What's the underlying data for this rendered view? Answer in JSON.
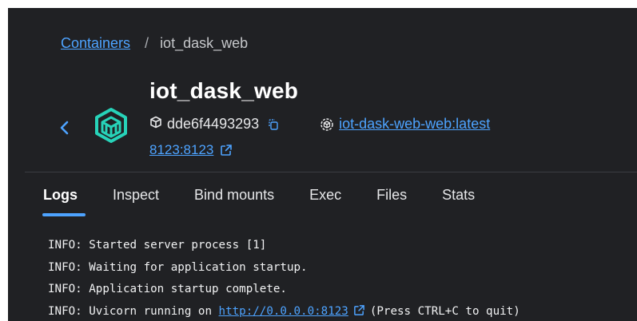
{
  "breadcrumb": {
    "root": "Containers",
    "separator": "/",
    "current": "iot_dask_web"
  },
  "container": {
    "name": "iot_dask_web",
    "id": "dde6f4493293",
    "image": "iot-dask-web-web:latest",
    "port": "8123:8123"
  },
  "tabs": [
    {
      "label": "Logs",
      "active": true
    },
    {
      "label": "Inspect"
    },
    {
      "label": "Bind mounts"
    },
    {
      "label": "Exec"
    },
    {
      "label": "Files"
    },
    {
      "label": "Stats"
    }
  ],
  "logs": {
    "line1": "INFO: Started server process [1]",
    "line2": "INFO: Waiting for application startup.",
    "line3": "INFO: Application startup complete.",
    "line4_prefix": "INFO: Uvicorn running on ",
    "line4_link": "http://0.0.0.0:8123",
    "line4_suffix": "(Press CTRL+C to quit)"
  },
  "colors": {
    "background": "#202124",
    "accent": "#4da3ff",
    "container_icon": "#27d3b9"
  }
}
